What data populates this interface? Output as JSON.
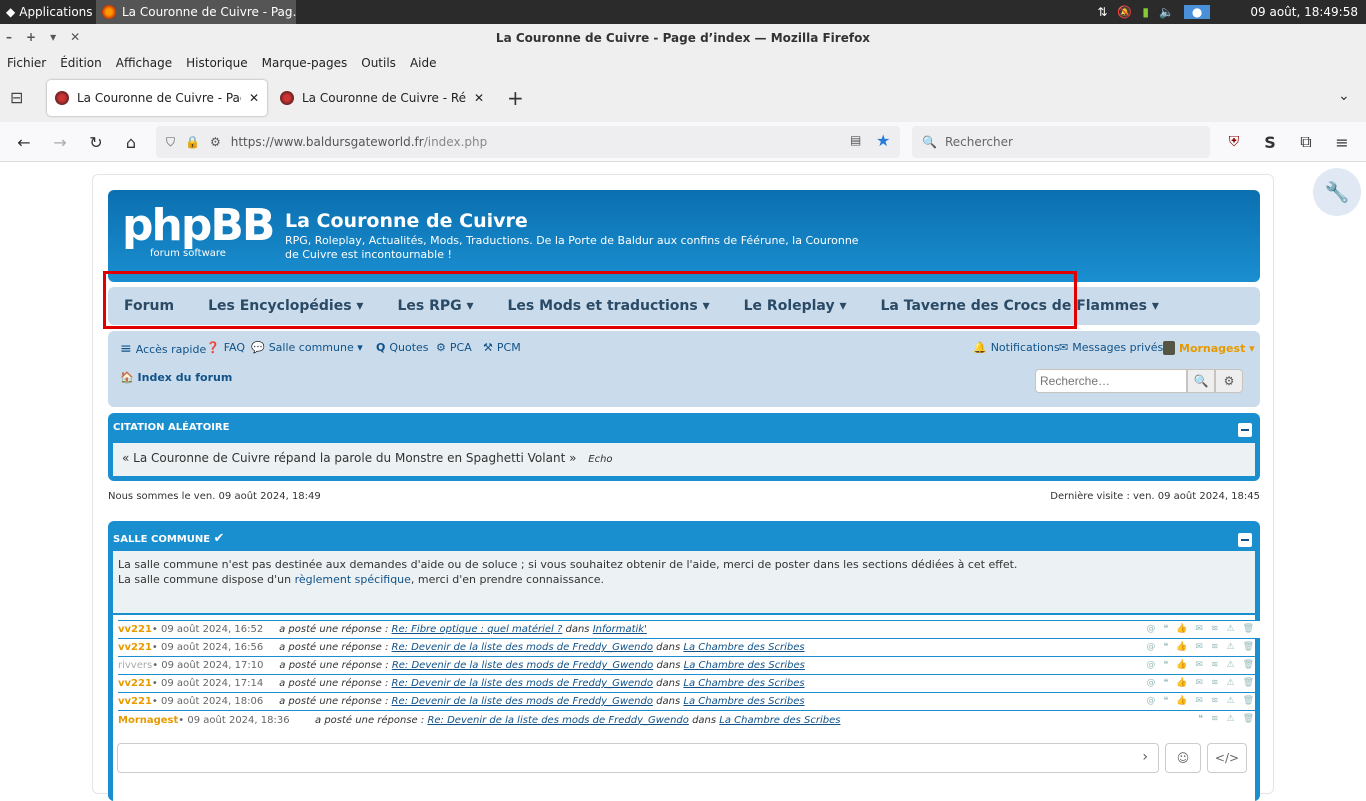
{
  "taskbar": {
    "apps_label": "Applications",
    "window_title": "La Couronne de Cuivre - Pag…",
    "clock": "09 août, 18:49:58"
  },
  "window": {
    "title": "La Couronne de Cuivre - Page d’index — Mozilla Firefox"
  },
  "menu": [
    "Fichier",
    "Édition",
    "Affichage",
    "Historique",
    "Marque-pages",
    "Outils",
    "Aide"
  ],
  "tabs": [
    {
      "label": "La Couronne de Cuivre - Page"
    },
    {
      "label": "La Couronne de Cuivre - Répo"
    }
  ],
  "urlbar": {
    "domain": "https://www.baldursgateworld.fr",
    "path": "/index.php"
  },
  "search": {
    "placeholder": "Rechercher"
  },
  "forum": {
    "logo": "phpBB",
    "logo_sub": "forum software",
    "title": "La Couronne de Cuivre",
    "description": "RPG, Roleplay, Actualités, Mods, Traductions. De la Porte de Baldur aux confins de Féérune, la Couronne de Cuivre est incontournable !",
    "nav": [
      "Forum",
      "Les Encyclopédies ▾",
      "Les RPG ▾",
      "Les Mods et traductions ▾",
      "Le Roleplay ▾",
      "La Taverne des Crocs de Flammes ▾"
    ],
    "quick": {
      "acces_rapide": "Accès rapide",
      "faq": "FAQ",
      "salle_commune": "Salle commune ▾",
      "quotes": "Quotes",
      "pca": "PCA",
      "pcm": "PCM",
      "notifications": "Notifications",
      "messages": "Messages privés",
      "user": "Mornagest ▾"
    },
    "breadcrumb": "Index du forum",
    "search_placeholder": "Recherche…",
    "citation": {
      "title": "CITATION ALÉATOIRE",
      "text": "« La Couronne de Cuivre répand la parole du Monstre en Spaghetti Volant »",
      "author": "Echo"
    },
    "date_now": "Nous sommes le ven. 09 août 2024, 18:49",
    "date_last": "Dernière visite : ven. 09 août 2024, 18:45",
    "salle": {
      "title": "SALLE COMMUNE",
      "line1": "La salle commune n'est pas destinée aux demandes d'aide ou de soluce ; si vous souhaitez obtenir de l'aide, merci de poster dans les sections dédiées à cet effet.",
      "line2a": "La salle commune dispose d'un",
      "line2link": "règlement spécifique",
      "line2b": ", merci d'en prendre connaissance."
    },
    "shouts": [
      {
        "user": "vv221",
        "date": " • 09 août 2024, 16:52",
        "act": "a posté une réponse :",
        "topic": "Re: Fibre optique : quel matériel ?",
        "dans": "dans",
        "forum": "Informatik'"
      },
      {
        "user": "vv221",
        "date": " • 09 août 2024, 16:56",
        "act": "a posté une réponse :",
        "topic": "Re: Devenir de la liste des mods de Freddy_Gwendo",
        "dans": "dans",
        "forum": "La Chambre des Scribes"
      },
      {
        "user": "rivvers",
        "date": " • 09 août 2024, 17:10",
        "act": "a posté une réponse :",
        "topic": "Re: Devenir de la liste des mods de Freddy_Gwendo",
        "dans": "dans",
        "forum": "La Chambre des Scribes"
      },
      {
        "user": "vv221",
        "date": " • 09 août 2024, 17:14",
        "act": "a posté une réponse :",
        "topic": "Re: Devenir de la liste des mods de Freddy_Gwendo",
        "dans": "dans",
        "forum": "La Chambre des Scribes"
      },
      {
        "user": "vv221",
        "date": " • 09 août 2024, 18:06",
        "act": "a posté une réponse :",
        "topic": "Re: Devenir de la liste des mods de Freddy_Gwendo",
        "dans": "dans",
        "forum": "La Chambre des Scribes"
      },
      {
        "user": "Mornagest",
        "date": " • 09 août 2024, 18:36",
        "act": "a posté une réponse :",
        "topic": "Re: Devenir de la liste des mods de Freddy_Gwendo",
        "dans": "dans",
        "forum": "La Chambre des Scribes"
      }
    ]
  }
}
